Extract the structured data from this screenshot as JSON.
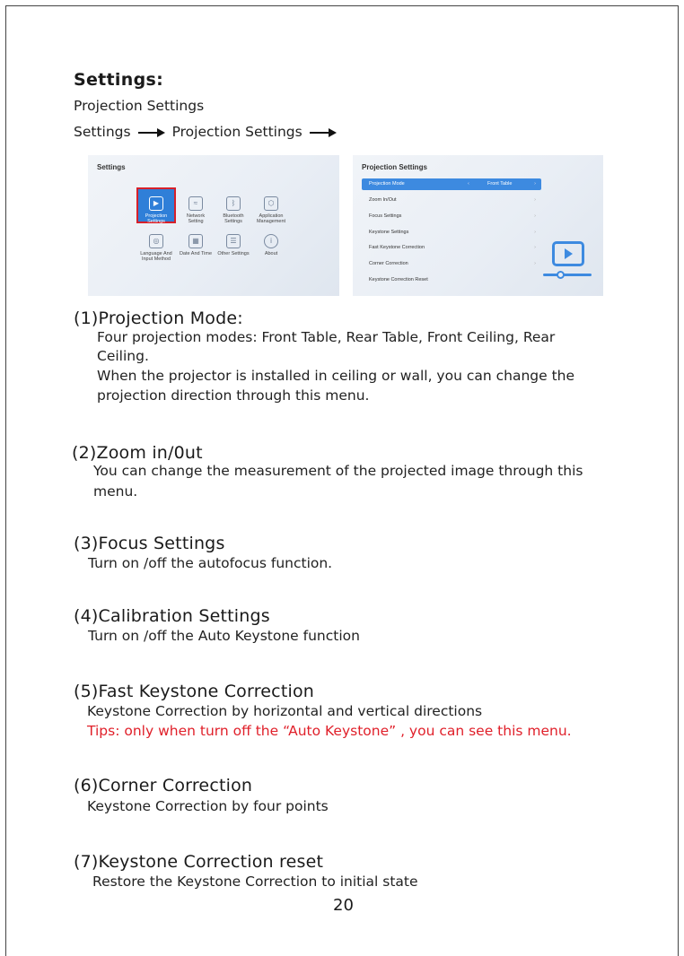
{
  "heading": "Settings:",
  "subheading": "Projection Settings",
  "path": {
    "from": "Settings",
    "to": "Projection Settings"
  },
  "screen1": {
    "title": "Settings",
    "tiles": [
      {
        "label": "Projection\nSettings",
        "icon": "projector-icon",
        "glyph": "▶"
      },
      {
        "label": "Network\nSetting",
        "icon": "wifi-icon",
        "glyph": "≈"
      },
      {
        "label": "Bluetooth\nSettings",
        "icon": "bluetooth-icon",
        "glyph": "ᛒ"
      },
      {
        "label": "Application\nManagement",
        "icon": "app-icon",
        "glyph": "⬡"
      },
      {
        "label": "Language And\nInput Method",
        "icon": "globe-icon",
        "glyph": "◎"
      },
      {
        "label": "Date And Time",
        "icon": "calendar-icon",
        "glyph": "▦"
      },
      {
        "label": "Other Settings",
        "icon": "list-icon",
        "glyph": "☰"
      },
      {
        "label": "About",
        "icon": "info-icon",
        "glyph": "i"
      }
    ]
  },
  "screen2": {
    "title": "Projection Settings",
    "rows": [
      {
        "label": "Projection Mode",
        "value": "Front Table"
      },
      {
        "label": "Zoom In/Out",
        "value": ""
      },
      {
        "label": "Focus Settings",
        "value": ""
      },
      {
        "label": "Keystone Settings",
        "value": ""
      },
      {
        "label": "Fast Keystone Correction",
        "value": ""
      },
      {
        "label": "Corner Correction",
        "value": ""
      },
      {
        "label": "Keystone Correction Reset",
        "value": ""
      }
    ]
  },
  "sections": [
    {
      "title": "(1)Projection Mode:",
      "lines": [
        "Four projection modes: Front Table, Rear Table, Front Ceiling, Rear",
        "Ceiling.",
        "When the projector is installed in ceiling or wall, you can change the",
        "projection direction through this menu."
      ]
    },
    {
      "title": "(2)Zoom in/0ut",
      "lines": [
        "You can change the measurement of the projected image through this",
        "menu."
      ]
    },
    {
      "title": "(3)Focus Settings",
      "lines": [
        "Turn on /off the autofocus function."
      ]
    },
    {
      "title": "(4)Calibration Settings",
      "lines": [
        "Turn on /off the Auto Keystone function"
      ]
    },
    {
      "title": "(5)Fast Keystone Correction",
      "lines": [
        "Keystone Correction by horizontal and vertical directions"
      ],
      "tip": "Tips: only when turn off the “Auto Keystone” , you can see this menu."
    },
    {
      "title": "(6)Corner Correction",
      "lines": [
        "Keystone Correction by four points"
      ]
    },
    {
      "title": "(7)Keystone Correction reset",
      "lines": [
        "Restore the Keystone Correction to initial state"
      ]
    }
  ],
  "page_number": "20",
  "colors": {
    "tip": "#e0202a",
    "accent": "#3d8ae0",
    "highlight": "#d6202a"
  }
}
